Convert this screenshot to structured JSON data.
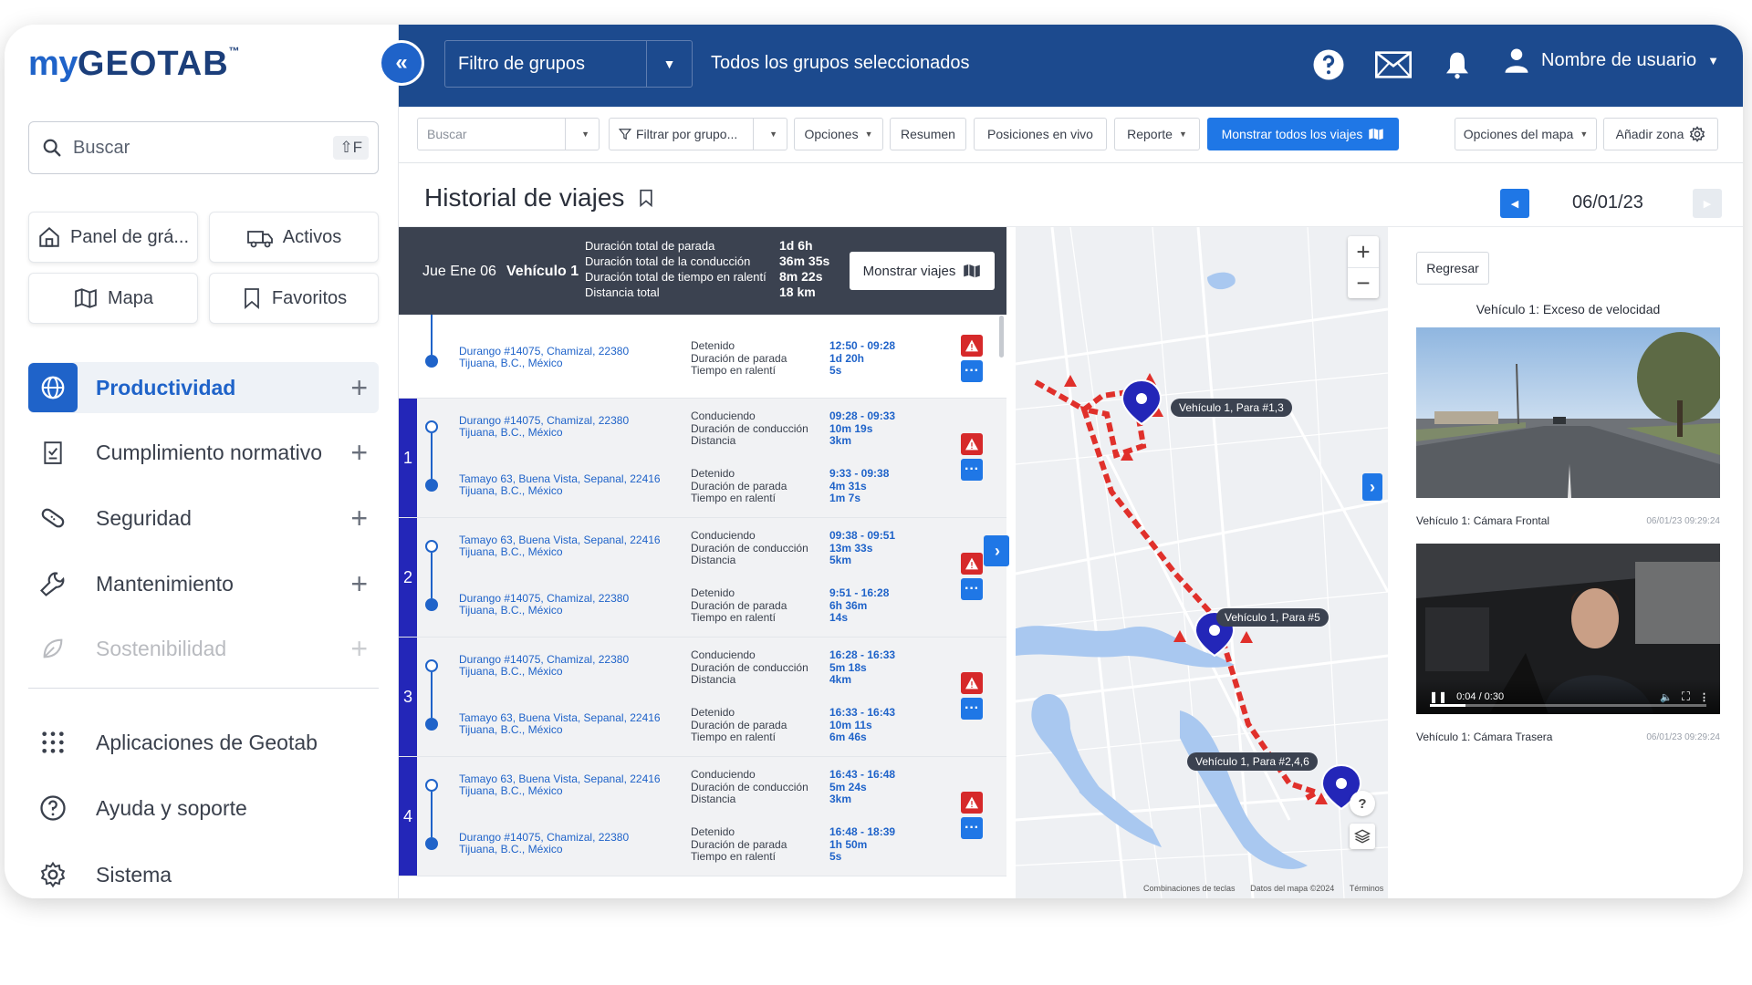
{
  "brand": {
    "logo_my": "my",
    "logo_geotab": "GEOTAB",
    "logo_tm": "™"
  },
  "sidebar": {
    "search_placeholder": "Buscar",
    "search_shortcut": "⇧F",
    "quick_links": [
      {
        "label": "Panel de grá...",
        "icon": "home-icon"
      },
      {
        "label": "Activos",
        "icon": "truck-icon"
      },
      {
        "label": "Mapa",
        "icon": "map-icon"
      },
      {
        "label": "Favoritos",
        "icon": "bookmark-icon"
      }
    ],
    "nav": [
      {
        "label": "Productividad",
        "icon": "globe-icon",
        "active": true,
        "expandable": true
      },
      {
        "label": "Cumplimiento normativo",
        "icon": "clipboard-icon",
        "expandable": true
      },
      {
        "label": "Seguridad",
        "icon": "bandage-icon",
        "expandable": true
      },
      {
        "label": "Mantenimiento",
        "icon": "wrench-icon",
        "expandable": true
      },
      {
        "label": "Sostenibilidad",
        "icon": "leaf-icon",
        "expandable": true
      },
      {
        "label": "Aplicaciones de Geotab",
        "icon": "grid-icon"
      },
      {
        "label": "Ayuda y soporte",
        "icon": "help-circle-icon"
      },
      {
        "label": "Sistema",
        "icon": "gear-icon"
      }
    ]
  },
  "topbar": {
    "group_filter_label": "Filtro de grupos",
    "groups_selected": "Todos los grupos seleccionados",
    "user_name": "Nombre de usuario"
  },
  "toolbar": {
    "search_placeholder": "Buscar",
    "filter_by_group": "Filtrar por grupo...",
    "options": "Opciones",
    "summary": "Resumen",
    "live_positions": "Posiciones en vivo",
    "report": "Reporte",
    "show_all_trips": "Monstrar todos los viajes",
    "map_options": "Opciones del mapa",
    "add_zone": "Añadir zona"
  },
  "page": {
    "title": "Historial de viajes",
    "date": "06/01/23"
  },
  "summary": {
    "date": "Jue Ene 06",
    "vehicle": "Vehículo 1",
    "labels": [
      "Duración total de parada",
      "Duración total de la conducción",
      "Duración total de tiempo en ralentí",
      "Distancia total"
    ],
    "values": [
      "1d 6h",
      "36m 35s",
      "8m 22s",
      "18 km"
    ],
    "show_trips": "Monstrar viajes"
  },
  "stop_first": {
    "address": [
      "Durango #14075, Chamizal, 22380",
      "Tijuana, B.C., México"
    ],
    "labels": [
      "Detenido",
      "Duración de parada",
      "Tiempo en ralentí"
    ],
    "values": [
      "12:50 - 09:28",
      "1d 20h",
      "5s"
    ]
  },
  "trips": [
    {
      "num": "1",
      "drive": {
        "address": [
          "Durango #14075, Chamizal, 22380",
          "Tijuana, B.C., México"
        ],
        "labels": [
          "Conduciendo",
          "Duración de conducción",
          "Distancia"
        ],
        "values": [
          "09:28 - 09:33",
          "10m 19s",
          "3km"
        ]
      },
      "stop": {
        "address": [
          "Tamayo 63, Buena Vista, Sepanal, 22416",
          "Tijuana, B.C., México"
        ],
        "labels": [
          "Detenido",
          "Duración de parada",
          "Tiempo en ralentí"
        ],
        "values": [
          "9:33 - 09:38",
          "4m 31s",
          "1m 7s"
        ]
      }
    },
    {
      "num": "2",
      "drive": {
        "address": [
          "Tamayo 63, Buena Vista, Sepanal, 22416",
          "Tijuana, B.C., México"
        ],
        "labels": [
          "Conduciendo",
          "Duración de conducción",
          "Distancia"
        ],
        "values": [
          "09:38 - 09:51",
          "13m 33s",
          "5km"
        ]
      },
      "stop": {
        "address": [
          "Durango #14075, Chamizal, 22380",
          "Tijuana, B.C., México"
        ],
        "labels": [
          "Detenido",
          "Duración de parada",
          "Tiempo en ralentí"
        ],
        "values": [
          "9:51 - 16:28",
          "6h 36m",
          "14s"
        ]
      }
    },
    {
      "num": "3",
      "drive": {
        "address": [
          "Durango #14075, Chamizal, 22380",
          "Tijuana, B.C., México"
        ],
        "labels": [
          "Conduciendo",
          "Duración de conducción",
          "Distancia"
        ],
        "values": [
          "16:28 - 16:33",
          "5m 18s",
          "4km"
        ]
      },
      "stop": {
        "address": [
          "Tamayo 63, Buena Vista, Sepanal, 22416",
          "Tijuana, B.C., México"
        ],
        "labels": [
          "Detenido",
          "Duración de parada",
          "Tiempo en ralentí"
        ],
        "values": [
          "16:33 - 16:43",
          "10m 11s",
          "6m 46s"
        ]
      }
    },
    {
      "num": "4",
      "drive": {
        "address": [
          "Tamayo 63, Buena Vista, Sepanal, 22416",
          "Tijuana, B.C., México"
        ],
        "labels": [
          "Conduciendo",
          "Duración de conducción",
          "Distancia"
        ],
        "values": [
          "16:43 - 16:48",
          "5m 24s",
          "3km"
        ]
      },
      "stop": {
        "address": [
          "Durango #14075, Chamizal, 22380",
          "Tijuana, B.C., México"
        ],
        "labels": [
          "Detenido",
          "Duración de parada",
          "Tiempo en ralentí"
        ],
        "values": [
          "16:48 - 18:39",
          "1h 50m",
          "5s"
        ]
      }
    }
  ],
  "map": {
    "labels": [
      "Vehículo 1, Para #1,3",
      "Vehículo 1, Para #5",
      "Vehículo 1, Para #2,4,6"
    ],
    "footer": [
      "Combinaciones de teclas",
      "Datos del mapa ©2024",
      "Términos"
    ],
    "route_color": "#e0302b",
    "water_color": "#a9c8f0"
  },
  "media": {
    "back": "Regresar",
    "event_title": "Vehículo 1: Exceso de velocidad",
    "front_caption": "Vehículo 1: Cámara Frontal",
    "front_time": "06/01/23 09:29:24",
    "rear_caption": "Vehículo 1: Cámara Trasera",
    "rear_time": "06/01/23 09:29:24",
    "video_time": "0:04 / 0:30",
    "video_progress": 0.13
  },
  "colors": {
    "brand_blue": "#1f63c9",
    "topbar": "#1c4a8e",
    "alert_red": "#d6292a",
    "trip_stripe": "#2326b8"
  }
}
